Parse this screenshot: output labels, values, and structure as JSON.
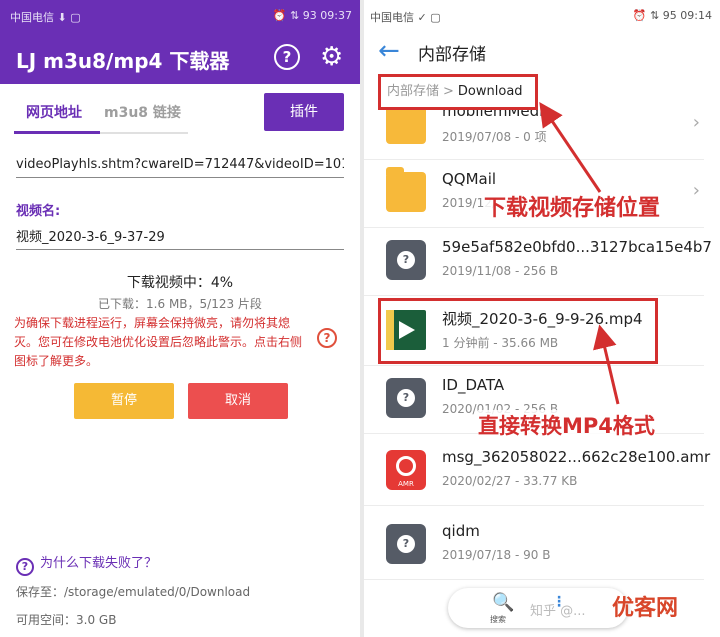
{
  "left_app": {
    "status": {
      "carrier": "中国电信 ⬇ ▢",
      "right": "⏰ ⇅ 93 09:37"
    },
    "title": "LJ m3u8/mp4 下载器",
    "help_glyph": "?",
    "gear_glyph": "⚙",
    "tabs": [
      {
        "label": "网页地址"
      },
      {
        "label": "m3u8 链接"
      }
    ],
    "plugin_label": "插件",
    "url_value": "videoPlayhls.shtm?cwareID=712447&videoID=101",
    "video_name_label": "视频名:",
    "video_name_value": "视频_2020-3-6_9-37-29",
    "progress_title": "下载视频中：4%",
    "progress_fraction": 0.04,
    "progress_sub": "已下载：1.6 MB，5/123 片段",
    "warning": "为确保下载进程运行，屏幕会保持微亮，请勿将其熄灭。您可在修改电池优化设置后忽略此警示。点击右侧图标了解更多。",
    "warn_glyph": "?",
    "pause_label": "暂停",
    "cancel_label": "取消",
    "fail_glyph": "?",
    "fail_link": "为什么下载失败了？",
    "save_to": "保存至：/storage/emulated/0/Download",
    "free_space": "可用空间：3.0 GB"
  },
  "right_app": {
    "status": {
      "carrier": "中国电信 ✓ ▢",
      "right": "⏰ ⇅ 95 09:14"
    },
    "back_glyph": "←",
    "title": "内部存储",
    "breadcrumb": [
      "内部存储",
      "Download"
    ],
    "breadcrumb_sep": ">",
    "files": [
      {
        "name": "mobilemMedia",
        "meta": "2019/07/08 - 0 项",
        "icon": "folder-icon",
        "chevron": true
      },
      {
        "name": "QQMail",
        "meta": "2019/12/...",
        "icon": "folder-icon",
        "chevron": true
      },
      {
        "name": "59e5af582e0bfd0...3127bca15e4b7",
        "meta": "2019/11/08 - 256 B",
        "icon": "unknown-file-icon",
        "chevron": false
      },
      {
        "name": "视频_2020-3-6_9-9-26.mp4",
        "meta": "1 分钟前 - 35.66 MB",
        "icon": "video-thumbnail-icon",
        "chevron": false
      },
      {
        "name": "ID_DATA",
        "meta": "2020/01/02 - 256 B",
        "icon": "unknown-file-icon",
        "chevron": false
      },
      {
        "name": "msg_362058022...662c28e100.amr",
        "meta": "2020/02/27 - 33.77 KB",
        "icon": "amr-file-icon",
        "chevron": false
      },
      {
        "name": "qidm",
        "meta": "2019/07/18 - 90 B",
        "icon": "unknown-file-icon",
        "chevron": false
      }
    ],
    "chevron_glyph": "›",
    "unknown_glyph": "?",
    "amr_text": "AMR",
    "annotation_storage": "下载视频存储位置",
    "annotation_mp4": "直接转换MP4格式",
    "search_glyph": "🔍",
    "search_label": "搜索",
    "menu_glyph": "⋮",
    "watermark": "知乎 @...",
    "logo": "优客网"
  },
  "colors": {
    "brand_purple": "#6a2fb5",
    "pause": "#f5b935",
    "cancel": "#ec4f4f",
    "annotation_red": "#d32f2f",
    "link_blue": "#3a86d8"
  }
}
